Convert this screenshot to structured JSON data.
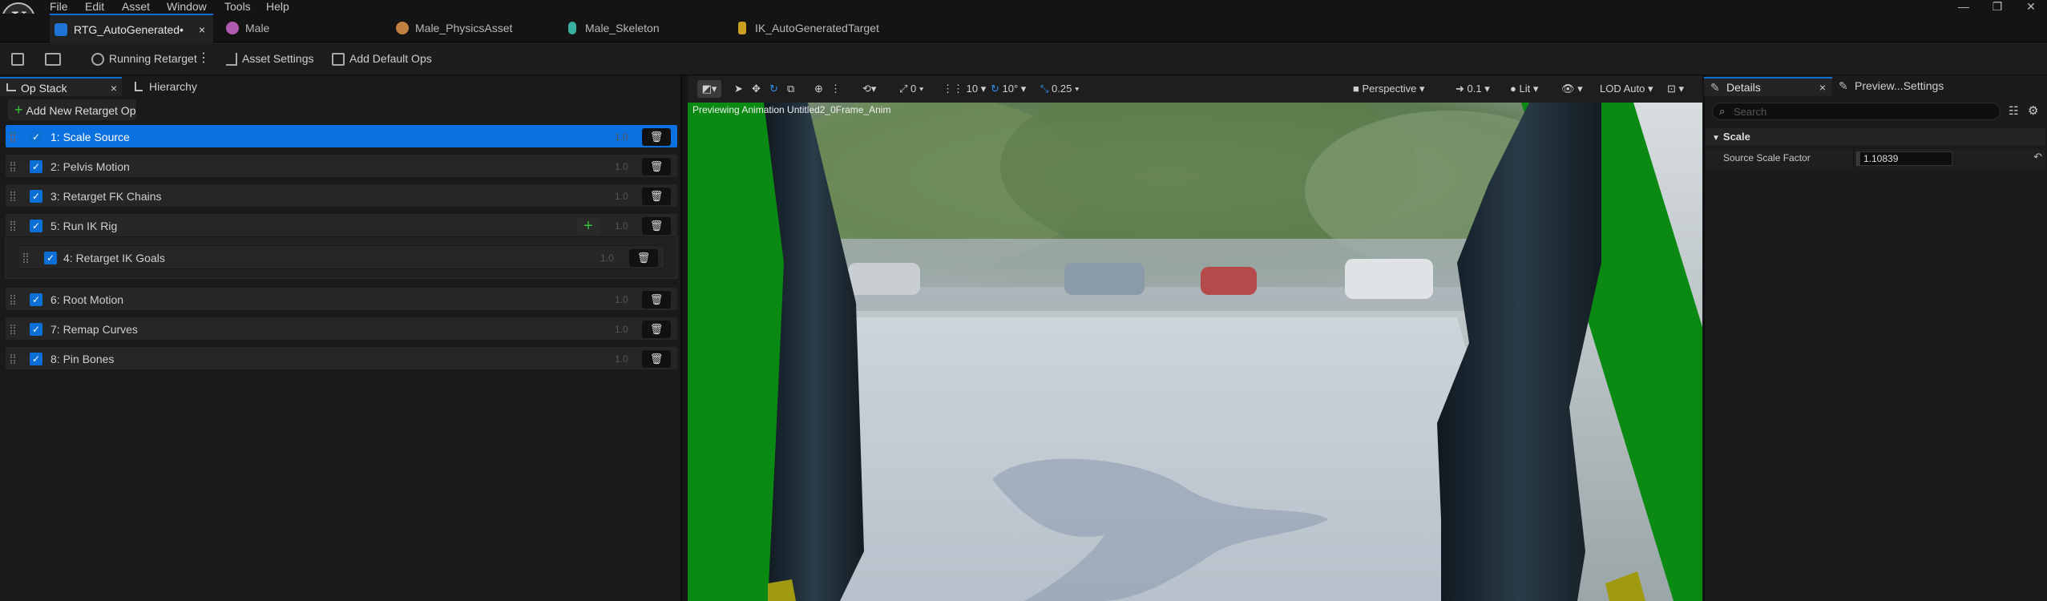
{
  "menu": [
    "File",
    "Edit",
    "Asset",
    "Window",
    "Tools",
    "Help"
  ],
  "window_controls": {
    "minimize": "—",
    "restore": "❐",
    "close": "✕"
  },
  "tabs": [
    {
      "label": "RTG_AutoGenerated•",
      "icon": "retarget-asset-icon",
      "active": true,
      "close": "×"
    },
    {
      "label": "Male",
      "icon": "skeletal-mesh-icon"
    },
    {
      "label": "Male_PhysicsAsset",
      "icon": "physics-asset-icon"
    },
    {
      "label": "Male_Skeleton",
      "icon": "skeleton-icon"
    },
    {
      "label": "IK_AutoGeneratedTarget",
      "icon": "ik-rig-icon"
    }
  ],
  "toolbar": {
    "running_retarget": "Running Retarget",
    "more": "⋮",
    "asset_settings": "Asset Settings",
    "add_default_ops": "Add Default Ops"
  },
  "left_panel": {
    "tab_op_stack": "Op Stack",
    "tab_op_stack_close": "×",
    "tab_hierarchy": "Hierarchy",
    "add_button": "Add New Retarget Op",
    "ops": [
      {
        "label": "1:  Scale Source",
        "ver": "1.0",
        "selected": true
      },
      {
        "label": "2:  Pelvis Motion",
        "ver": "1.0"
      },
      {
        "label": "3:  Retarget FK Chains",
        "ver": "1.0"
      },
      {
        "label": "5:  Run IK Rig",
        "ver": "1.0",
        "has_add": true
      },
      {
        "label": "4:  Retarget IK Goals",
        "ver": "1.0",
        "child": true
      },
      {
        "label": "6:  Root Motion",
        "ver": "1.0"
      },
      {
        "label": "7:  Remap Curves",
        "ver": "1.0"
      },
      {
        "label": "8:  Pin Bones",
        "ver": "1.0"
      }
    ]
  },
  "viewport": {
    "toolbar": {
      "snap_translate": "0",
      "snap_rotate": "10",
      "snap_scale": "10°",
      "snap_scale_value": "0.25",
      "perspective": "Perspective",
      "speed": "0.1",
      "lit": "Lit",
      "lod": "LOD Auto"
    },
    "overlay_text": "Previewing Animation Untitled2_0Frame_Anim"
  },
  "right_panel": {
    "tab_details": "Details",
    "tab_details_close": "×",
    "tab_preview": "Preview...Settings",
    "search_placeholder": "Search",
    "section": "Scale",
    "property_label": "Source Scale Factor",
    "property_value": "1.10839"
  },
  "colors": {
    "accent": "#0b70e0",
    "checkbox": "#0b6fd6",
    "add_green": "#39c23a",
    "green_bar": "#0a8a12"
  }
}
